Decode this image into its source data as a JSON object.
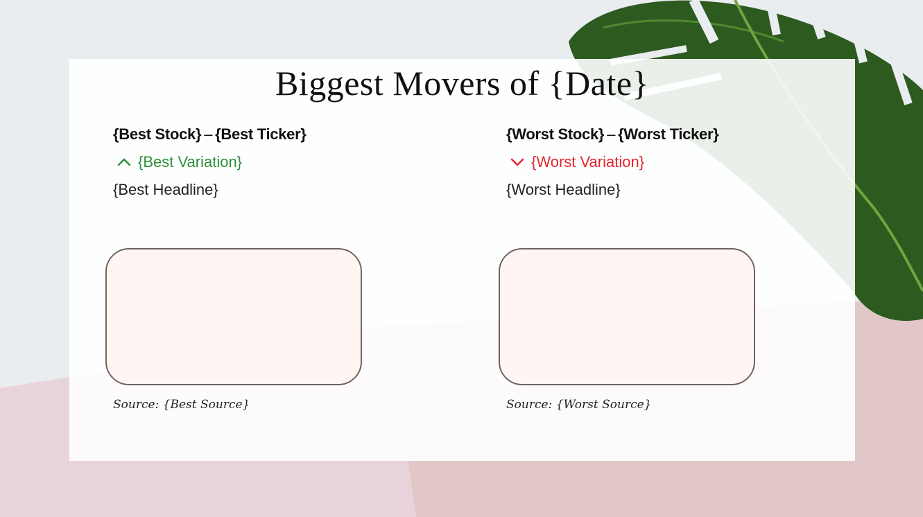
{
  "title": "Biggest Movers of {Date}",
  "best": {
    "stock": "{Best Stock}",
    "separator": "–",
    "ticker": "{Best Ticker}",
    "variation": "{Best Variation}",
    "headline": "{Best Headline}",
    "source": "Source: {Best Source}",
    "arrow_icon": "chevron-up-icon",
    "color": "#2f8f3a"
  },
  "worst": {
    "stock": "{Worst Stock}",
    "separator": "–",
    "ticker": "{Worst Ticker}",
    "variation": "{Worst Variation}",
    "headline": "{Worst Headline}",
    "source": "Source: {Worst Source}",
    "arrow_icon": "chevron-down-icon",
    "color": "#e3262d"
  },
  "colors": {
    "background_top": "#e9edf0",
    "background_pink": "#ead4db",
    "leaf_green": "#2d5a1f",
    "chart_fill": "#fff6f4",
    "chart_border": "#6e6360"
  }
}
